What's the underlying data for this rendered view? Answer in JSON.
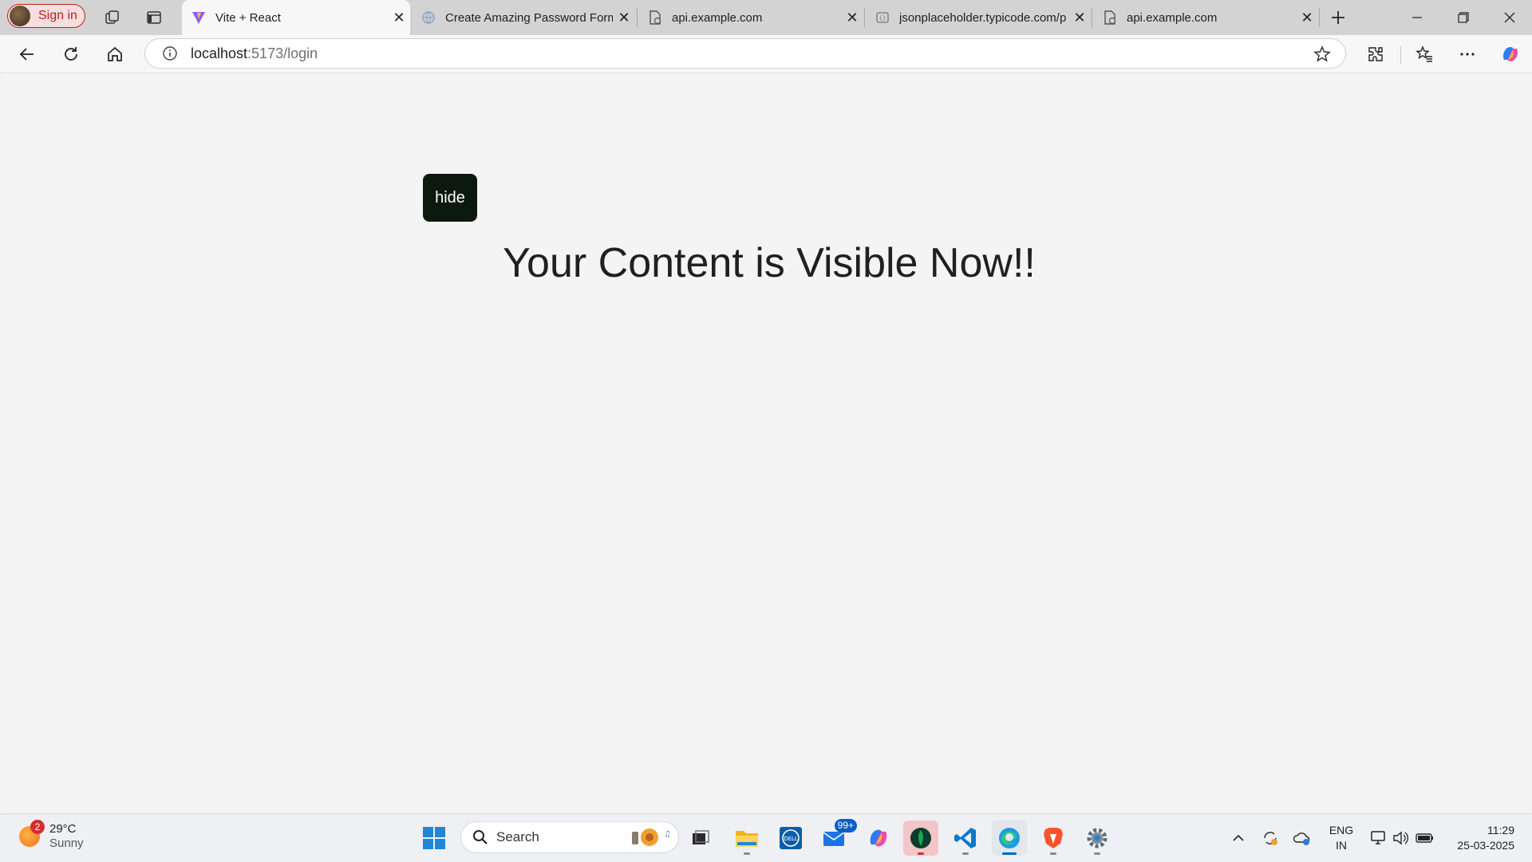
{
  "browser": {
    "signin_label": "Sign in",
    "tabs": [
      {
        "title": "Vite + React",
        "active": true
      },
      {
        "title": "Create Amazing Password Form",
        "active": false
      },
      {
        "title": "api.example.com",
        "active": false
      },
      {
        "title": "jsonplaceholder.typicode.com/p",
        "active": false
      },
      {
        "title": "api.example.com",
        "active": false
      }
    ],
    "address": {
      "host": "localhost",
      "path": ":5173/login"
    }
  },
  "page": {
    "hide_button_label": "hide",
    "content_text": "Your Content is Visible Now!!"
  },
  "taskbar": {
    "weather": {
      "temp": "29°C",
      "condition": "Sunny",
      "badge": "2"
    },
    "search_label": "Search",
    "mail_badge": "99+",
    "lang_line1": "ENG",
    "lang_line2": "IN",
    "time": "11:29",
    "date": "25-03-2025"
  },
  "colors": {
    "hide_button_bg": "#0c1a0e",
    "signin_border": "#b3261e",
    "accent": "#0067c0"
  }
}
